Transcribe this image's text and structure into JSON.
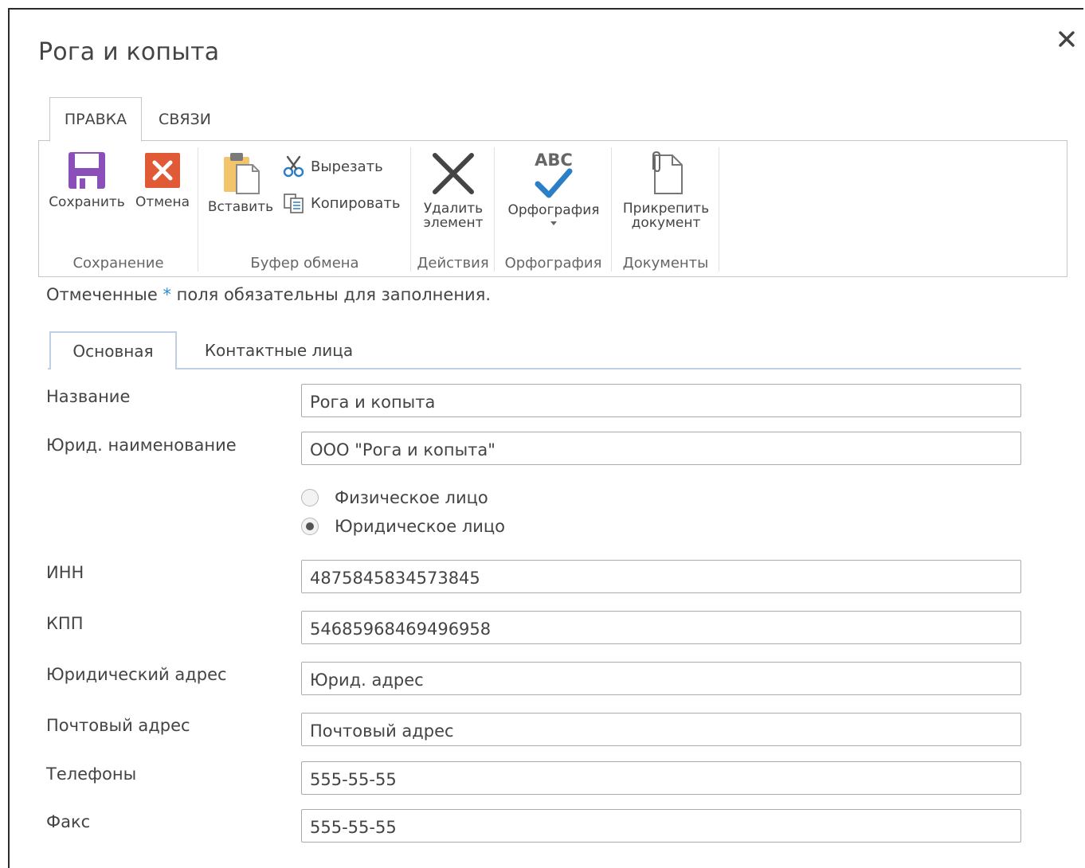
{
  "dialog": {
    "title": "Рога и копыта"
  },
  "ribbon": {
    "tabs": [
      "ПРАВКА",
      "СВЯЗИ"
    ],
    "groups": {
      "save": {
        "label": "Сохранение",
        "save_label": "Сохранить",
        "cancel_label": "Отмена"
      },
      "clipboard": {
        "label": "Буфер обмена",
        "paste_label": "Вставить",
        "cut_label": "Вырезать",
        "copy_label": "Копировать"
      },
      "actions": {
        "label": "Действия",
        "delete_label_1": "Удалить",
        "delete_label_2": "элемент"
      },
      "spelling": {
        "label": "Орфография",
        "spelling_label": "Орфография",
        "abc": "ABC"
      },
      "documents": {
        "label": "Документы",
        "attach_label_1": "Прикрепить",
        "attach_label_2": "документ"
      }
    }
  },
  "required_note": {
    "prefix": "Отмеченные ",
    "star": "*",
    "suffix": " поля обязательны для заполнения."
  },
  "form_tabs": [
    "Основная",
    "Контактные лица"
  ],
  "fields": {
    "name": {
      "label": "Название",
      "value": "Рога и копыта"
    },
    "legal_name": {
      "label": "Юрид. наименование",
      "value": "ООО \"Рога и копыта\""
    },
    "person_type": {
      "options": [
        "Физическое лицо",
        "Юридическое лицо"
      ],
      "selected": "Юридическое лицо"
    },
    "inn": {
      "label": "ИНН",
      "value": "4875845834573845"
    },
    "kpp": {
      "label": "КПП",
      "value": "54685968469496958"
    },
    "legal_address": {
      "label": "Юридический адрес",
      "value": "Юрид. адрес"
    },
    "postal_address": {
      "label": "Почтовый адрес",
      "value": "Почтовый адрес"
    },
    "phones": {
      "label": "Телефоны",
      "value": "555-55-55"
    },
    "fax": {
      "label": "Факс",
      "value": "555-55-55"
    }
  },
  "colors": {
    "save_icon": "#8a4fb8",
    "cancel_icon": "#e15a37",
    "spell_check": "#2a7fc6",
    "required_star": "#2a8dd4",
    "tab_border": "#bfd0e4"
  }
}
